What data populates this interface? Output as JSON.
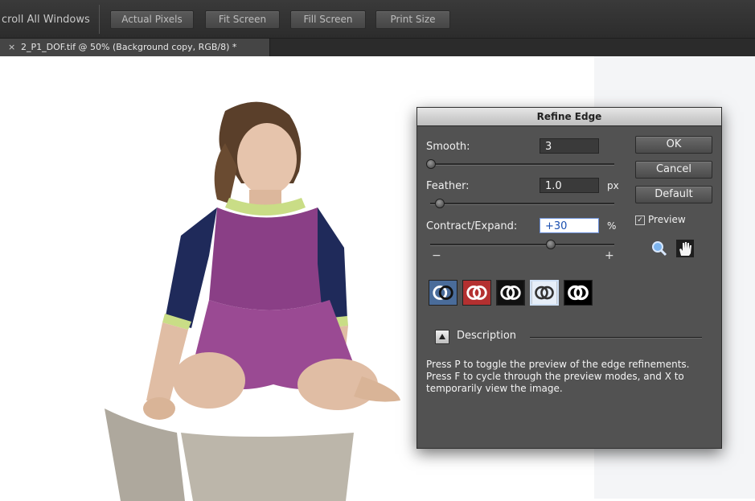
{
  "toolbar": {
    "scroll_all_label": "croll All Windows",
    "buttons": [
      "Actual Pixels",
      "Fit Screen",
      "Fill Screen",
      "Print Size"
    ]
  },
  "document": {
    "close_glyph": "×",
    "tab_title": "2_P1_DOF.tif @ 50% (Background copy, RGB/8) *"
  },
  "dialog": {
    "title": "Refine Edge",
    "smooth": {
      "label": "Smooth:",
      "value": "3",
      "slider_fraction": 0.0
    },
    "feather": {
      "label": "Feather:",
      "value": "1.0",
      "unit": "px",
      "slider_fraction": 0.05
    },
    "contract_expand": {
      "label": "Contract/Expand:",
      "value": "+30",
      "unit": "%",
      "slider_fraction": 0.65,
      "min_label": "−",
      "max_label": "+"
    },
    "buttons": {
      "ok": "OK",
      "cancel": "Cancel",
      "default": "Default"
    },
    "preview": {
      "label": "Preview",
      "checked": true,
      "check_glyph": "✓"
    },
    "tools": [
      "zoom-icon",
      "hand-icon"
    ],
    "view_modes": [
      "mode-black-white-red",
      "mode-red-overlay",
      "mode-black-bg",
      "mode-white-bg-selected",
      "mode-black-mask"
    ],
    "selected_mode_index": 3,
    "description": {
      "label": "Description",
      "text": "Press P to toggle the preview of the edge refinements. Press F to cycle through the preview modes, and X to temporarily view the image."
    }
  },
  "colors": {
    "accent_arrow": "#d21f1f",
    "dialog_bg": "#525252",
    "toolbar_bg": "#333333"
  }
}
